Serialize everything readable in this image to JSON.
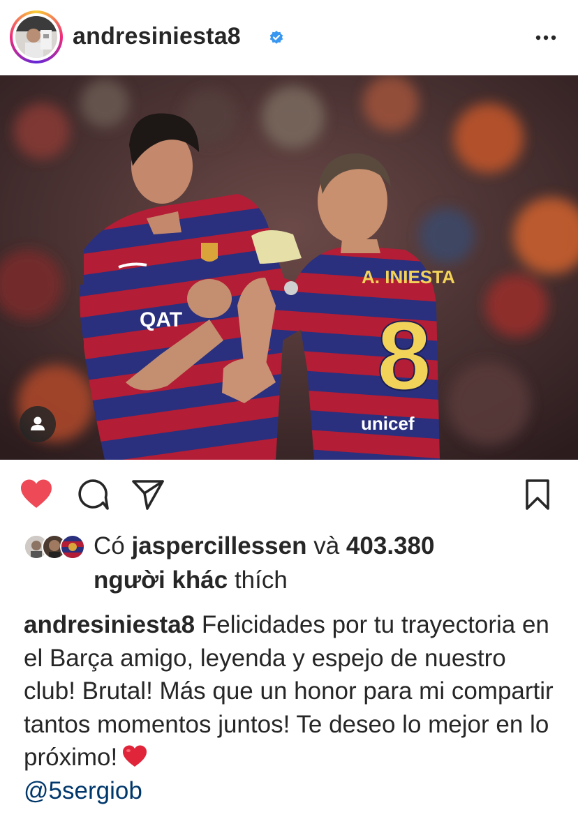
{
  "post": {
    "username": "andresiniesta8",
    "verified_icon": "verified-badge-icon",
    "more_icon": "more-dots-icon",
    "photo": {
      "shirt_name": "A. INIESTA",
      "shirt_number": "8",
      "sponsor_front": "QAT",
      "sponsor_back": "unicef"
    }
  },
  "actions": {
    "like_icon": "heart-filled-icon",
    "comment_icon": "comment-bubble-icon",
    "share_icon": "paper-plane-icon",
    "save_icon": "bookmark-icon",
    "like_color": "#ed4956"
  },
  "likes": {
    "prefix": "Có",
    "liker": "jaspercillessen",
    "and": "và",
    "count": "403.380",
    "others": "người khác",
    "suffix": "thích"
  },
  "caption": {
    "username": "andresiniesta8",
    "text": "Felicidades por tu trayectoria en el Barça amigo, leyenda y espejo de nuestro club! Brutal! Más que un honor para mi compartir tantos momentos juntos! Te deseo lo mejor en lo próximo!",
    "mention": "@5sergiob"
  }
}
